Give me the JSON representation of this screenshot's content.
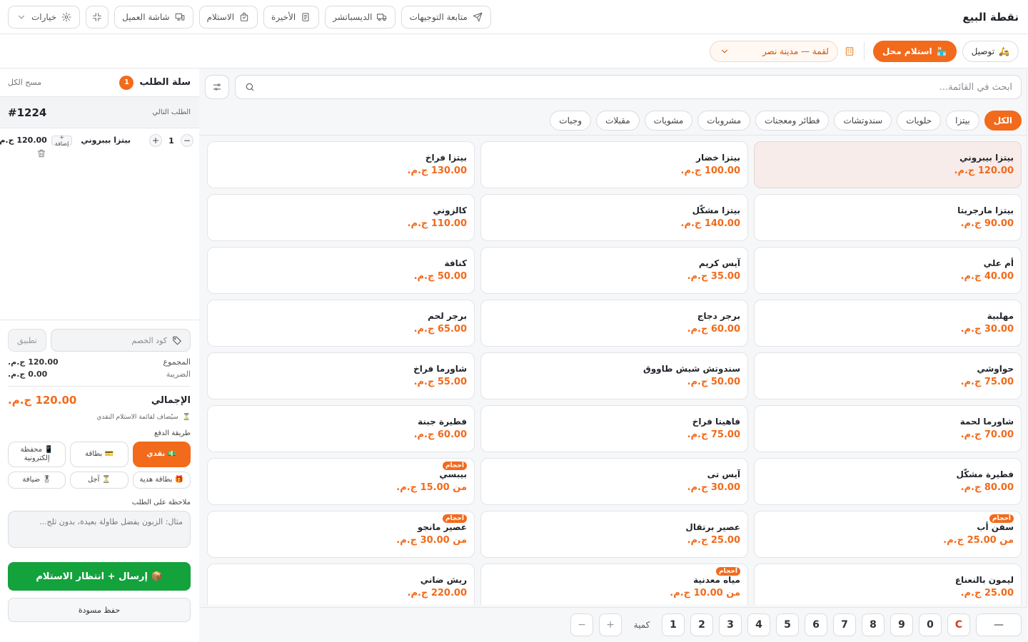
{
  "header": {
    "title": "نقطة البيع",
    "nav": [
      {
        "label": "متابعة التوجيهات",
        "icon": "send-icon"
      },
      {
        "label": "الديسباتشر",
        "icon": "truck-icon"
      },
      {
        "label": "الأخيرة",
        "icon": "receipt-icon"
      },
      {
        "label": "الاستلام",
        "icon": "bag-icon"
      },
      {
        "label": "شاشة العميل",
        "icon": "monitor-icon"
      },
      {
        "label": "",
        "icon": "fullscreen-icon"
      },
      {
        "label": "خيارات",
        "icon": "gear-icon"
      }
    ]
  },
  "order_type": {
    "delivery": {
      "label": "توصيل",
      "icon": "scooter-icon"
    },
    "pickup": {
      "label": "استلام محل",
      "icon": "store-icon"
    },
    "branch": {
      "label": "لقمة — مدينة نصر",
      "icon": "building-icon"
    }
  },
  "search": {
    "placeholder": "ابحث في القائمة..."
  },
  "categories": [
    "الكل",
    "بيتزا",
    "حلويات",
    "سندوتشات",
    "فطائر ومعجنات",
    "مشروبات",
    "مشويات",
    "مقبلات",
    "وجبات"
  ],
  "active_category": "الكل",
  "size_badge": "أحجام",
  "menu_items": [
    {
      "name": "بيتزا بيبروني",
      "price": "120.00 ج.م.",
      "active": true
    },
    {
      "name": "بيتزا خضار",
      "price": "100.00 ج.م."
    },
    {
      "name": "بيتزا فراخ",
      "price": "130.00 ج.م."
    },
    {
      "name": "بيتزا مارجريتا",
      "price": "90.00 ج.م."
    },
    {
      "name": "بيتزا مشكّل",
      "price": "140.00 ج.م."
    },
    {
      "name": "كالزوني",
      "price": "110.00 ج.م."
    },
    {
      "name": "أم علي",
      "price": "40.00 ج.م."
    },
    {
      "name": "آيس كريم",
      "price": "35.00 ج.م."
    },
    {
      "name": "كنافة",
      "price": "50.00 ج.م."
    },
    {
      "name": "مهلبية",
      "price": "30.00 ج.م."
    },
    {
      "name": "برجر دجاج",
      "price": "60.00 ج.م."
    },
    {
      "name": "برجر لحم",
      "price": "65.00 ج.م."
    },
    {
      "name": "حواوشي",
      "price": "75.00 ج.م."
    },
    {
      "name": "سندوتش شيش طاووق",
      "price": "50.00 ج.م."
    },
    {
      "name": "شاورما فراخ",
      "price": "55.00 ج.م."
    },
    {
      "name": "شاورما لحمة",
      "price": "70.00 ج.م."
    },
    {
      "name": "فاهيتا فراخ",
      "price": "75.00 ج.م."
    },
    {
      "name": "فطيرة جبنة",
      "price": "60.00 ج.م."
    },
    {
      "name": "فطيرة مشكّل",
      "price": "80.00 ج.م."
    },
    {
      "name": "آيس تى",
      "price": "30.00 ج.م."
    },
    {
      "name": "بيبسي",
      "price": "من 15.00 ج.م.",
      "sized": true
    },
    {
      "name": "سفن أب",
      "price": "من 25.00 ج.م.",
      "sized": true
    },
    {
      "name": "عصير برتقال",
      "price": "25.00 ج.م."
    },
    {
      "name": "عصير مانجو",
      "price": "من 30.00 ج.م.",
      "sized": true
    },
    {
      "name": "ليمون بالنعناع",
      "price": "25.00 ج.م."
    },
    {
      "name": "مياه معدنية",
      "price": "من 10.00 ج.م.",
      "sized": true
    },
    {
      "name": "ريش ضاني",
      "price": "220.00 ج.م."
    }
  ],
  "keypad": {
    "backspace": "—",
    "clear": "C",
    "digits": [
      "0",
      "9",
      "8",
      "7",
      "6",
      "5",
      "4",
      "3",
      "2",
      "1"
    ],
    "qty_label": "كمية",
    "plus": "+",
    "minus": "−"
  },
  "cart": {
    "title": "سلة الطلب",
    "count": "1",
    "clear_all": "مسح الكل",
    "next_order_label": "الطلب التالي",
    "next_order_number": "#1224",
    "lines": [
      {
        "name": "بيتزا بيبروني",
        "qty": "1",
        "add_label": "+ إضافة",
        "price": "120.00 ج.م."
      }
    ],
    "discount_placeholder": "كود الخصم",
    "apply_label": "تطبيق",
    "subtotal_label": "المجموع",
    "subtotal": "120.00 ج.م.",
    "tax_label": "الضريبة",
    "tax": "0.00 ج.م.",
    "total_label": "الإجمالي",
    "total": "120.00 ج.م.",
    "hint": "سيُضاف لقائمة الاستلام النقدي",
    "payment_title": "طريقة الدفع",
    "payments": [
      {
        "label": "💵 نقدي",
        "active": true
      },
      {
        "label": "💳 بطاقة"
      },
      {
        "label": "📱 محفظة إلكترونية"
      },
      {
        "label": "🎁 بطاقة هدية"
      },
      {
        "label": "⏳ آجل"
      },
      {
        "label": "🎖 ضيافة"
      }
    ],
    "note_title": "ملاحظة على الطلب",
    "note_placeholder": "مثال: الزبون يفضل طاولة بعيدة، بدون ثلج...",
    "send_label": "📦 إرسال + انتظار الاستلام",
    "draft_label": "حفظ مسودة"
  },
  "colors": {
    "accent": "#f26a1b",
    "success": "#13a23c",
    "active_card": "#f7ecea"
  }
}
